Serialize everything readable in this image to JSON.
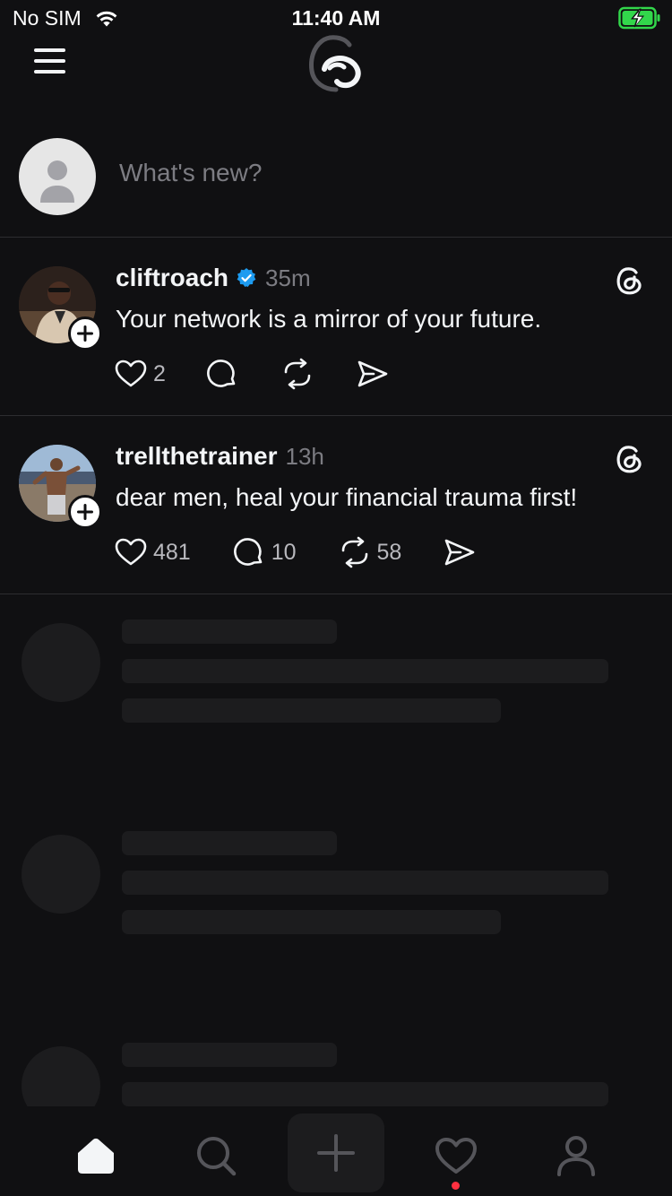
{
  "status_bar": {
    "carrier": "No SIM",
    "time": "11:40 AM",
    "wifi_icon": "wifi-icon",
    "battery_icon": "battery-charging-icon",
    "battery_color": "#32d74b"
  },
  "header": {
    "menu_icon": "menu-icon",
    "logo_icon": "threads-logo-icon"
  },
  "compose": {
    "placeholder": "What's new?",
    "avatar_icon": "default-avatar-icon"
  },
  "posts": [
    {
      "username": "cliftroach",
      "verified": true,
      "timestamp": "35m",
      "text": "Your network is a mirror of your future.",
      "likes": "2",
      "replies": "",
      "reposts": ""
    },
    {
      "username": "trellthetrainer",
      "verified": false,
      "timestamp": "13h",
      "text": "dear men, heal your financial trauma first!",
      "likes": "481",
      "replies": "10",
      "reposts": "58"
    }
  ],
  "tab_bar": {
    "items": [
      "home-icon",
      "search-icon",
      "new-post-icon",
      "activity-icon",
      "profile-icon"
    ],
    "active": "home-icon"
  },
  "colors": {
    "background": "#101012",
    "text": "#f3f5f7",
    "secondary_text": "#7c7c82",
    "verified": "#1d9bf0",
    "notification_dot": "#ff3040",
    "skeleton": "#1c1c1e"
  }
}
